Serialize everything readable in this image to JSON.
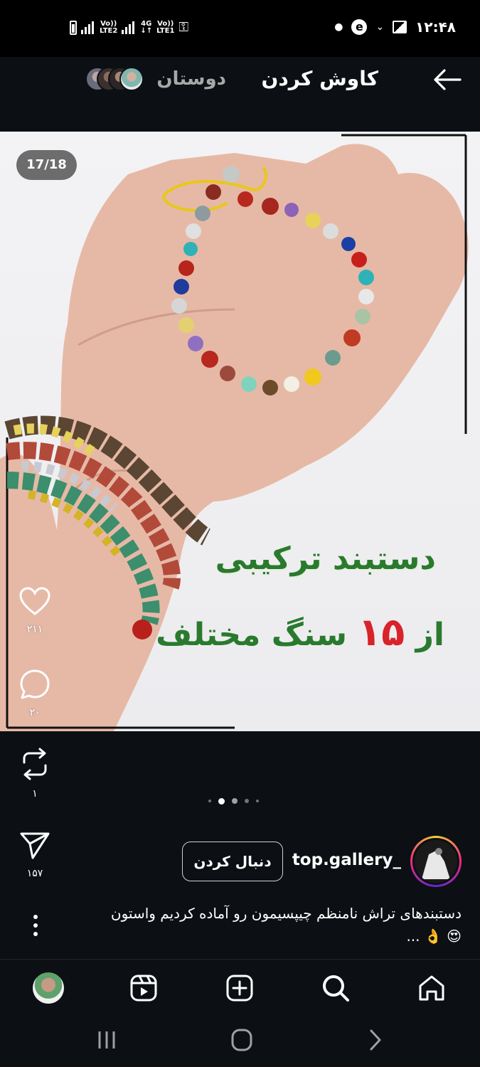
{
  "status_bar": {
    "time": "۱۲:۴۸",
    "lte1_label": "LTE1",
    "lte2_label": "LTE2",
    "net_4g": "4G",
    "volte_label": "Vo))"
  },
  "header": {
    "title": "کاوش کردن",
    "friends_label": "دوستان"
  },
  "post": {
    "counter": "17/18",
    "overlay_line1": "دستبند ترکیبی",
    "overlay_line2_prefix": "از",
    "overlay_line2_number": "۱۵",
    "overlay_line2_suffix": "سنگ مختلف",
    "likes": "۲۱۱",
    "comments": "۲۰",
    "reposts": "۱",
    "shares": "۱۵۷",
    "carousel_dots": 5,
    "carousel_active": 1,
    "username": "top.gallery_",
    "follow_label": "دنبال کردن",
    "caption_line1": "دستبندهای تراش نامنظم چیپسیمون رو آماده کردیم واستون",
    "caption_line2": "😍 👌 ..."
  },
  "colors": {
    "background": "#0c1014",
    "overlay_green": "#2a7a2e",
    "overlay_red": "#d9232a"
  }
}
